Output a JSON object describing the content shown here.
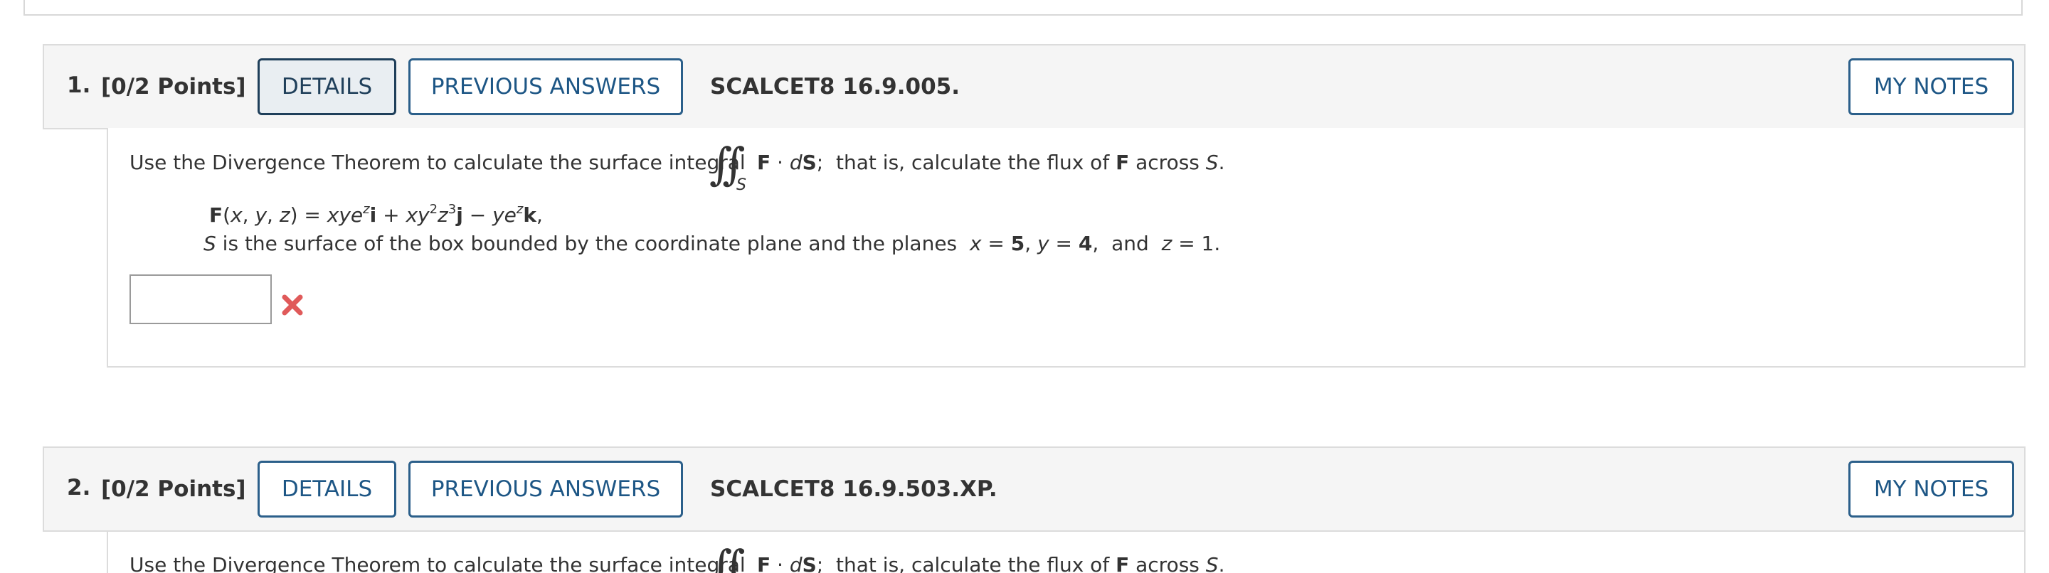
{
  "questions": [
    {
      "number": "1.",
      "points": "[0/2 Points]",
      "details_label": "DETAILS",
      "previous_answers_label": "PREVIOUS ANSWERS",
      "code": "SCALCET8 16.9.005.",
      "my_notes_label": "MY NOTES",
      "intro_text": "Use the Divergence Theorem to calculate the surface integral",
      "integral_symbol": "∬",
      "integral_subscript": "S",
      "after_integral": "F · dS;  that is, calculate the flux of F across S.",
      "field": "F(x, y, z) = xye^z i + xy^2 z^3 j − ye^z k,",
      "surface": "S is the surface of the box bounded by the coordinate plane and the planes  x = 5, y = 4,  and  z = 1.",
      "answer_value": "",
      "answer_status": "incorrect",
      "status_icon": "cross-icon"
    },
    {
      "number": "2.",
      "points": "[0/2 Points]",
      "details_label": "DETAILS",
      "previous_answers_label": "PREVIOUS ANSWERS",
      "code": "SCALCET8 16.9.503.XP.",
      "my_notes_label": "MY NOTES",
      "intro_text": "Use the Divergence Theorem to calculate the surface integral",
      "integral_symbol": "∬",
      "after_integral": "F · dS;  that is, calculate the flux of F across S."
    }
  ],
  "colors": {
    "accent": "#1d5685",
    "header_bg": "#f5f5f5",
    "border": "#dcdcdc",
    "incorrect": "#e05a5a"
  }
}
